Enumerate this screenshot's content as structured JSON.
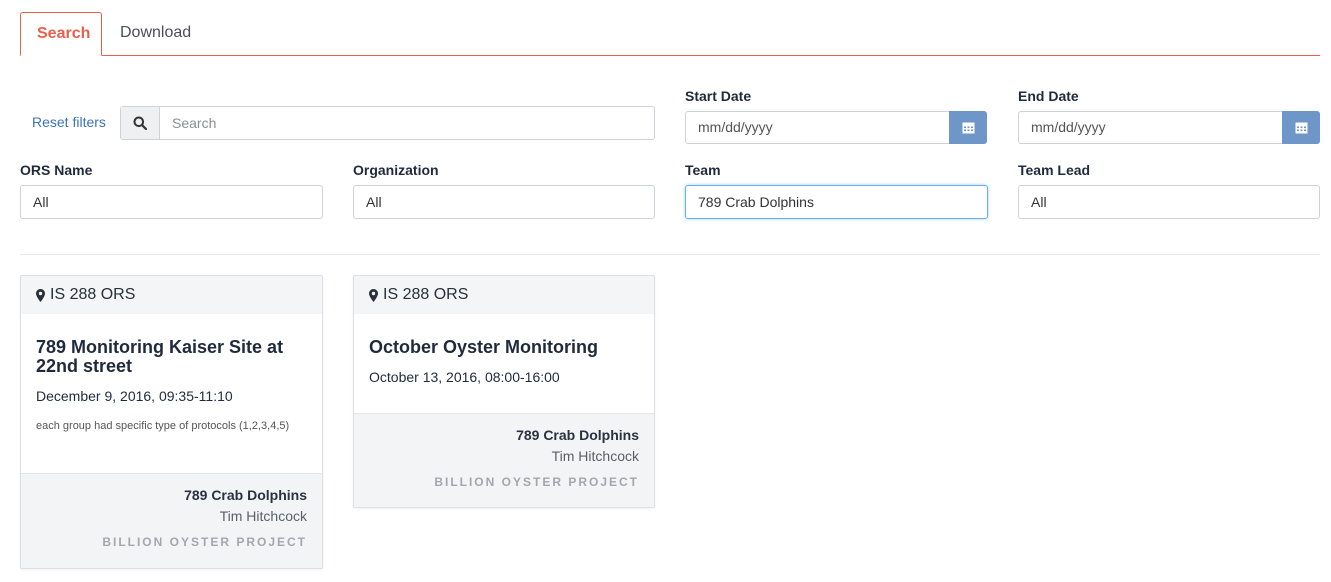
{
  "tabs": [
    {
      "label": "Search",
      "active": true
    },
    {
      "label": "Download",
      "active": false
    }
  ],
  "filters": {
    "reset_label": "Reset filters",
    "search_placeholder": "Search",
    "start_date": {
      "label": "Start Date",
      "placeholder": "mm/dd/yyyy"
    },
    "end_date": {
      "label": "End Date",
      "placeholder": "mm/dd/yyyy"
    },
    "ors_name": {
      "label": "ORS Name",
      "value": "All"
    },
    "organization": {
      "label": "Organization",
      "value": "All"
    },
    "team": {
      "label": "Team",
      "value": "789 Crab Dolphins"
    },
    "team_lead": {
      "label": "Team Lead",
      "value": "All"
    }
  },
  "cards": [
    {
      "site": "IS 288 ORS",
      "title": "789 Monitoring Kaiser Site at 22nd street",
      "date": "December 9, 2016, 09:35-11:10",
      "description": "each group had specific type of protocols (1,2,3,4,5)",
      "team": "789 Crab Dolphins",
      "lead": "Tim Hitchcock",
      "organization": "BILLION OYSTER PROJECT"
    },
    {
      "site": "IS 288 ORS",
      "title": "October Oyster Monitoring",
      "date": "October 13, 2016, 08:00-16:00",
      "description": "",
      "team": "789 Crab Dolphins",
      "lead": "Tim Hitchcock",
      "organization": "BILLION OYSTER PROJECT"
    }
  ],
  "colors": {
    "accent": "#e8604c",
    "link": "#3e73b8",
    "calendar_button": "#6f96c8"
  },
  "icons": {
    "search": "search-icon",
    "calendar": "calendar-icon",
    "location": "map-marker-icon"
  }
}
